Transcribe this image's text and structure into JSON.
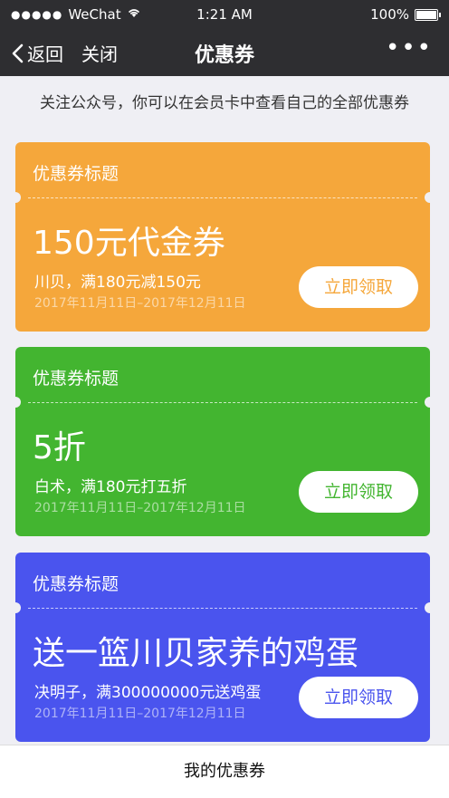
{
  "status": {
    "carrier": "WeChat",
    "time": "1:21 AM",
    "battery": "100%"
  },
  "nav": {
    "back_label": "返回",
    "close_label": "关闭",
    "title": "优惠券",
    "more": "•••"
  },
  "notice": "关注公众号，你可以在会员卡中查看自己的全部优惠券",
  "coupons": [
    {
      "title": "优惠券标题",
      "amount": "150元代金券",
      "condition": "川贝，满180元减150元",
      "date": "2017年11月11日–2017年12月11日",
      "button": "立即领取",
      "color": "#f5a73b"
    },
    {
      "title": "优惠券标题",
      "amount": "5折",
      "condition": "白术，满180元打五折",
      "date": "2017年11月11日–2017年12月11日",
      "button": "立即领取",
      "color": "#43b530"
    },
    {
      "title": "优惠券标题",
      "amount": "送一篮川贝家养的鸡蛋",
      "condition": "决明子，满300000000元送鸡蛋",
      "date": "2017年11月11日–2017年12月11日",
      "button": "立即领取",
      "color": "#4a54ee"
    }
  ],
  "bottom_label": "我的优惠券"
}
